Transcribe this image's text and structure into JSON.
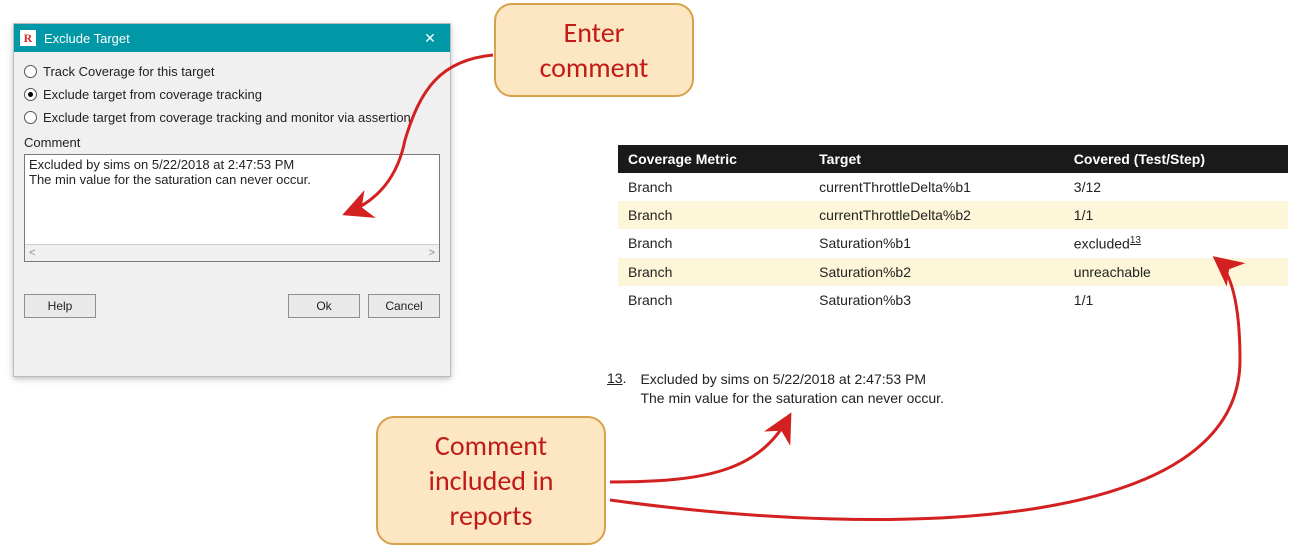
{
  "dialog": {
    "logo": "R",
    "title": "Exclude Target",
    "radios": [
      {
        "label": "Track Coverage for this target",
        "selected": false
      },
      {
        "label": "Exclude target from coverage tracking",
        "selected": true
      },
      {
        "label": "Exclude target from coverage tracking and monitor via assertion",
        "selected": false
      }
    ],
    "comment_label": "Comment",
    "comment_lines": [
      "Excluded by sims on 5/22/2018 at 2:47:53 PM",
      "The min value for the saturation can never occur."
    ],
    "buttons": {
      "help": "Help",
      "ok": "Ok",
      "cancel": "Cancel"
    }
  },
  "callouts": {
    "enter": "Enter comment",
    "included": "Comment included in reports"
  },
  "table": {
    "headers": [
      "Coverage Metric",
      "Target",
      "Covered (Test/Step)"
    ],
    "rows": [
      {
        "metric": "Branch",
        "target": "currentThrottleDelta%b1",
        "covered": "3/12",
        "alt": false
      },
      {
        "metric": "Branch",
        "target": "currentThrottleDelta%b2",
        "covered": "1/1",
        "alt": true
      },
      {
        "metric": "Branch",
        "target": "Saturation%b1",
        "covered": "excluded",
        "sup": "13",
        "alt": false
      },
      {
        "metric": "Branch",
        "target": "Saturation%b2",
        "covered": "unreachable",
        "alt": true
      },
      {
        "metric": "Branch",
        "target": "Saturation%b3",
        "covered": "1/1",
        "alt": false
      }
    ]
  },
  "footnote": {
    "num": "13",
    "lines": [
      "Excluded by sims on 5/22/2018 at 2:47:53 PM",
      "The min value for the saturation can never occur."
    ]
  }
}
